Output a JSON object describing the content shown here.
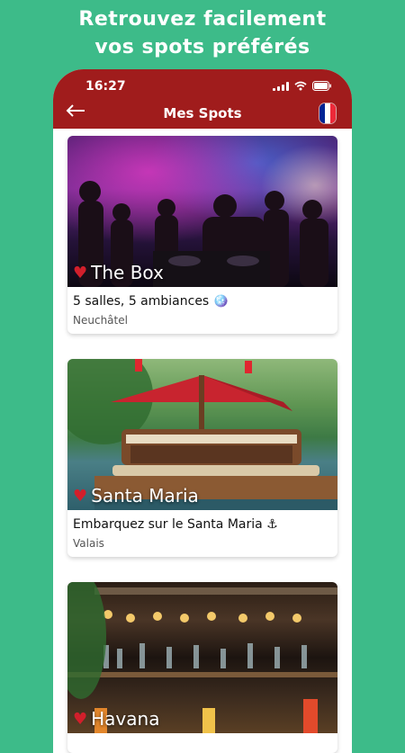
{
  "promo": {
    "line1": "Retrouvez facilement",
    "line2": "vos spots préférés"
  },
  "status_bar": {
    "time": "16:27"
  },
  "app_bar": {
    "back_icon": "arrow-left-icon",
    "title": "Mes Spots",
    "language_flag": "france-flag-icon",
    "flag_colors": [
      "#002395",
      "#ffffff",
      "#ed2939"
    ]
  },
  "colors": {
    "background": "#3dbb89",
    "app_bar": "#a01c1c",
    "heart": "#d21f2b"
  },
  "spots": [
    {
      "name": "The Box",
      "description": "5 salles, 5 ambiances 🪩",
      "location": "Neuchâtel",
      "favorite": true
    },
    {
      "name": "Santa Maria",
      "description": "Embarquez sur le Santa Maria ⚓",
      "location": "Valais",
      "favorite": true
    },
    {
      "name": "Havana",
      "description": "",
      "location": "",
      "favorite": true
    }
  ]
}
